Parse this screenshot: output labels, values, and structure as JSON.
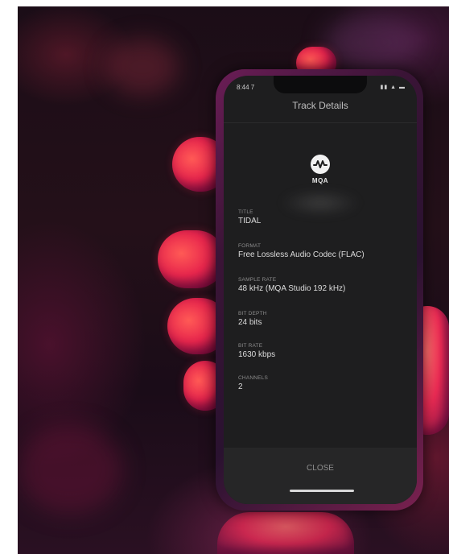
{
  "status_bar": {
    "time": "8:44 7",
    "icons": "▮▮ ▲ ▬"
  },
  "screen": {
    "title": "Track Details"
  },
  "logo": {
    "text": "MQA",
    "icon": "mqa-waveform-icon"
  },
  "fields": [
    {
      "label": "TITLE",
      "value": "TIDAL"
    },
    {
      "label": "FORMAT",
      "value": "Free Lossless Audio Codec (FLAC)"
    },
    {
      "label": "SAMPLE RATE",
      "value": "48 kHz (MQA Studio 192 kHz)"
    },
    {
      "label": "BIT DEPTH",
      "value": "24 bits"
    },
    {
      "label": "BIT RATE",
      "value": "1630 kbps"
    },
    {
      "label": "CHANNELS",
      "value": "2"
    }
  ],
  "footer": {
    "close_label": "CLOSE"
  }
}
